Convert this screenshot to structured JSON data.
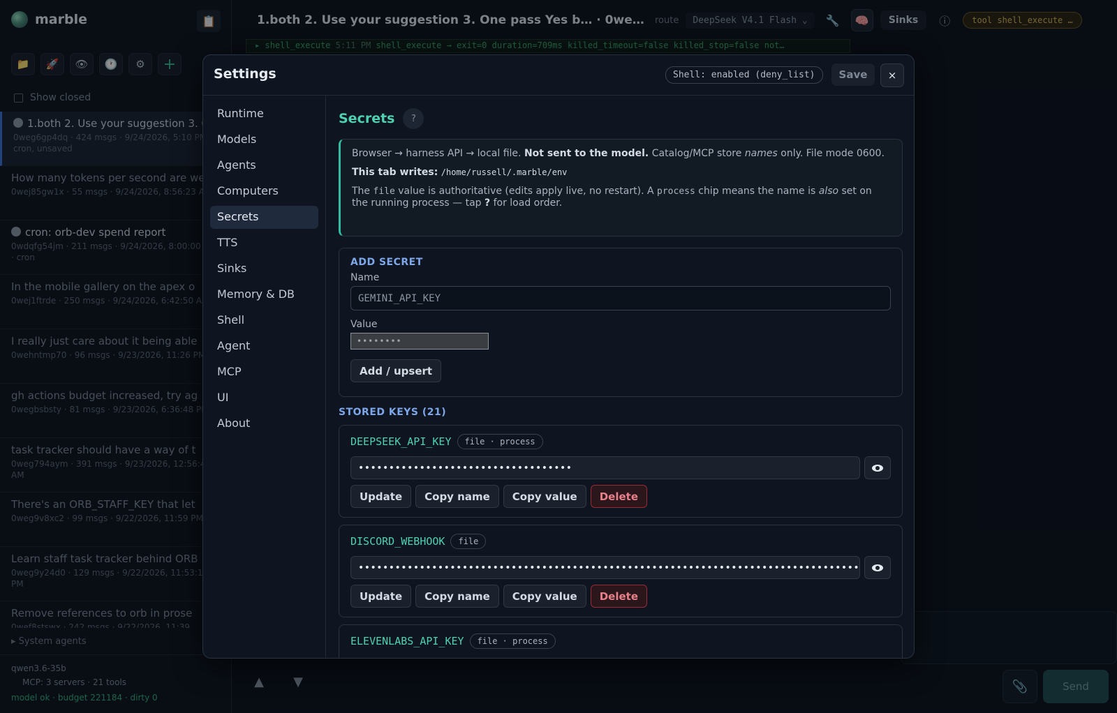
{
  "app": {
    "name": "marble"
  },
  "sidebar": {
    "show_closed": "Show closed",
    "chats": [
      {
        "title": "1.both 2. Use your suggestion 3. One pass Yes b",
        "meta": "0weg6gp4dq · 424 msgs · 9/24/2026, 5:10 PM · cron, unsaved",
        "clock": true,
        "active": true
      },
      {
        "title": "How many tokens per second are we",
        "meta": "0wej85gw1x · 55 msgs · 9/24/2026, 8:56:23 AM",
        "clock": false
      },
      {
        "title": "cron: orb-dev spend report",
        "meta": "0wdqfg54jm · 211 msgs · 9/24/2026, 8:00:00 AM · cron",
        "clock": true,
        "bright": true
      },
      {
        "title": "In the mobile gallery on the apex o",
        "meta": "0wej1ftrde · 250 msgs · 9/24/2026, 6:42:50 AM",
        "clock": false
      },
      {
        "title": "I really just care about it being able",
        "meta": "0wehntmp70 · 96 msgs · 9/23/2026, 11:26 PM",
        "clock": false
      },
      {
        "title": "gh actions budget increased, try ag",
        "meta": "0wegbsbsty · 81 msgs · 9/23/2026, 6:36:48 PM",
        "clock": false
      },
      {
        "title": "task tracker should have a way of t",
        "meta": "0weg794aym · 391 msgs · 9/23/2026, 12:56:46 AM",
        "clock": false
      },
      {
        "title": "There's an ORB_STAFF_KEY that let",
        "meta": "0weg9v8xc2 · 99 msgs · 9/22/2026, 11:59 PM",
        "clock": false
      },
      {
        "title": "Learn staff task tracker behind ORB",
        "meta": "0weg9y24d0 · 129 msgs · 9/22/2026, 11:53:10 PM",
        "clock": false
      },
      {
        "title": "Remove references to orb in prose",
        "meta": "0wef8stswx · 242 msgs · 9/22/2026, 11:39",
        "clock": false
      }
    ],
    "system_agents": "▸ System agents",
    "footer": {
      "model": "qwen3.6-35b",
      "mcp": "MCP: 3 servers · 21 tools",
      "status": "model ok · budget 221184 · dirty 0"
    }
  },
  "topbar": {
    "title": "1.both 2. Use your suggestion 3. One pass Yes b… · 0we…",
    "route_label": "route",
    "model": "DeepSeek V4.1 Flash",
    "sinks": "Sinks",
    "tool_pill": "tool shell_execute …"
  },
  "log": {
    "marker": "▸",
    "name": "shell_execute",
    "time": "5:11 PM",
    "text": "shell_execute → exit=0 duration=709ms killed_timeout=false killed_stop=false not…"
  },
  "composer": {
    "send": "Send"
  },
  "settings": {
    "title": "Settings",
    "shell_status": "Shell: enabled (deny_list)",
    "save": "Save",
    "close": "×",
    "nav": [
      "Runtime",
      "Models",
      "Agents",
      "Computers",
      "Secrets",
      "TTS",
      "Sinks",
      "Memory & DB",
      "Shell",
      "Agent",
      "MCP",
      "UI",
      "About"
    ],
    "active_nav": "Secrets",
    "secrets": {
      "title": "Secrets",
      "help": "?",
      "info": {
        "line1_a": "Browser → harness API → local file.",
        "line1_b": "Not sent to the model.",
        "line1_c": "Catalog/MCP store",
        "line1_d": "names",
        "line1_e": "only. File mode 0600.",
        "writes_label": "This tab writes:",
        "writes_path": "/home/russell/.marble/env",
        "line3_a": "The",
        "line3_b": "file",
        "line3_c": "value is authoritative (edits apply live, no restart). A",
        "line3_d": "process",
        "line3_e": "chip means the name is",
        "line3_f": "also",
        "line3_g": "set on the running process — tap",
        "line3_h": "?",
        "line3_i": "for load order."
      },
      "add": {
        "label": "ADD SECRET",
        "name_label": "Name",
        "name_placeholder": "GEMINI_API_KEY",
        "value_label": "Value",
        "value_mask": "••••••••",
        "button": "Add / upsert"
      },
      "stored_label": "STORED KEYS (21)",
      "keys": [
        {
          "name": "DEEPSEEK_API_KEY",
          "tag": "file · process",
          "mask": "•••••••••••••••••••••••••••••••••••"
        },
        {
          "name": "DISCORD_WEBHOOK",
          "tag": "file",
          "mask": "•••••••••••••••••••••••••••••••••••••••••••••••••••••••••••••••••••••••••••••••••••"
        },
        {
          "name": "ELEVENLABS_API_KEY",
          "tag": "file · process",
          "mask": ""
        }
      ],
      "actions": {
        "update": "Update",
        "copy_name": "Copy name",
        "copy_value": "Copy value",
        "delete": "Delete"
      }
    }
  }
}
